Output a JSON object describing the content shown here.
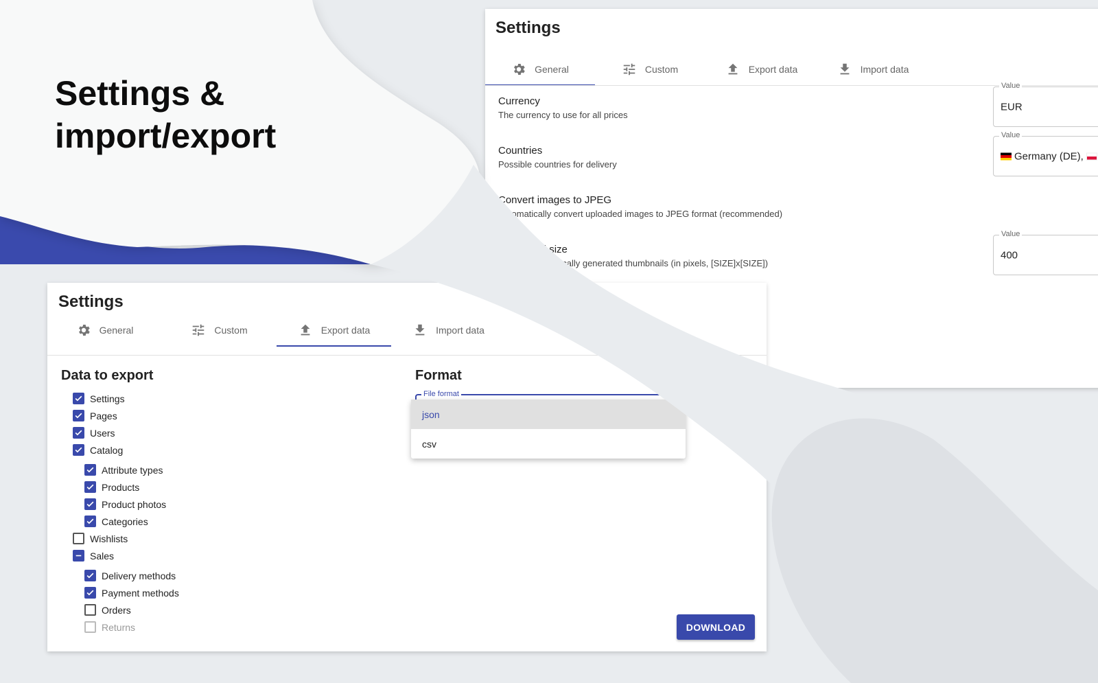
{
  "headline": {
    "line1": "Settings &",
    "line2": "import/export"
  },
  "back_panel": {
    "title": "Settings",
    "tabs": [
      {
        "label": "General",
        "icon": "gear-icon",
        "active": true
      },
      {
        "label": "Custom",
        "icon": "sliders-icon",
        "active": false
      },
      {
        "label": "Export data",
        "icon": "upload-icon",
        "active": false
      },
      {
        "label": "Import data",
        "icon": "download-icon",
        "active": false
      }
    ],
    "settings": [
      {
        "title": "Currency",
        "subtitle": "The currency to use for all prices",
        "field_label": "Value",
        "value": "EUR"
      },
      {
        "title": "Countries",
        "subtitle": "Possible countries for delivery",
        "field_label": "Value",
        "value": "Germany (DE), "
      },
      {
        "title": "Convert images to JPEG",
        "subtitle": "Automatically convert uploaded images to JPEG format (recommended)"
      },
      {
        "title": "Thumbnail size",
        "subtitle": "Size of automatically generated thumbnails (in pixels, [SIZE]x[SIZE])",
        "field_label": "Value",
        "value": "400"
      }
    ]
  },
  "front_panel": {
    "title": "Settings",
    "tabs": [
      {
        "label": "General",
        "icon": "gear-icon",
        "active": false
      },
      {
        "label": "Custom",
        "icon": "sliders-icon",
        "active": false
      },
      {
        "label": "Export data",
        "icon": "upload-icon",
        "active": true
      },
      {
        "label": "Import data",
        "icon": "download-icon",
        "active": false
      }
    ],
    "data_to_export": {
      "heading": "Data to export",
      "items": [
        {
          "label": "Settings",
          "state": "checked",
          "indent": 0
        },
        {
          "label": "Pages",
          "state": "checked",
          "indent": 0
        },
        {
          "label": "Users",
          "state": "checked",
          "indent": 0
        },
        {
          "label": "Catalog",
          "state": "checked",
          "indent": 0
        },
        {
          "label": "Attribute types",
          "state": "checked",
          "indent": 1
        },
        {
          "label": "Products",
          "state": "checked",
          "indent": 1
        },
        {
          "label": "Product photos",
          "state": "checked",
          "indent": 1
        },
        {
          "label": "Categories",
          "state": "checked",
          "indent": 1
        },
        {
          "label": "Wishlists",
          "state": "unchecked",
          "indent": 0
        },
        {
          "label": "Sales",
          "state": "indeterminate",
          "indent": 0
        },
        {
          "label": "Delivery methods",
          "state": "checked",
          "indent": 1
        },
        {
          "label": "Payment methods",
          "state": "checked",
          "indent": 1
        },
        {
          "label": "Orders",
          "state": "unchecked",
          "indent": 1
        },
        {
          "label": "Returns",
          "state": "disabled",
          "indent": 1
        }
      ]
    },
    "format": {
      "heading": "Format",
      "field_label": "File format",
      "options": [
        {
          "label": "json",
          "selected": true
        },
        {
          "label": "csv",
          "selected": false
        }
      ]
    },
    "download_label": "DOWNLOAD"
  },
  "colors": {
    "accent": "#3949ab",
    "background": "#e9ecef",
    "panel": "#ffffff",
    "hero": "#f8f9f9"
  }
}
